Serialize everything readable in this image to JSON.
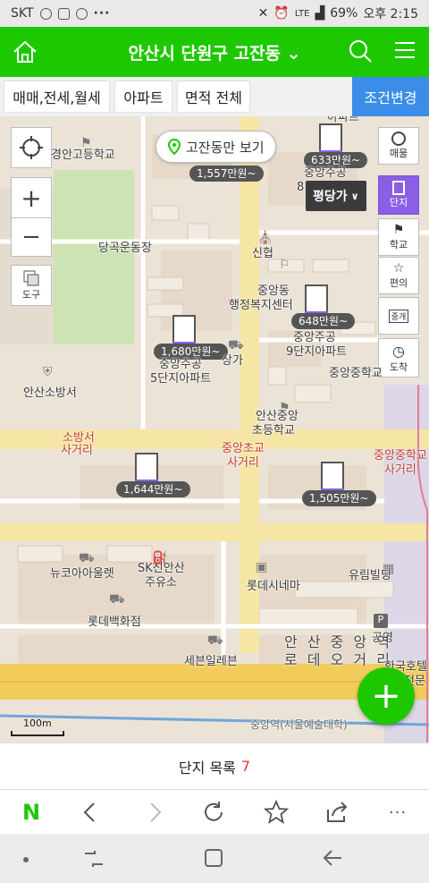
{
  "status": {
    "carrier": "SKT",
    "dots": "···",
    "battery": "69%",
    "time": "오후 2:15",
    "lte": "LTE"
  },
  "header": {
    "title": "안산시 단원구 고잔동 ⌄"
  },
  "filters": {
    "chip1": "매매,전세,월세",
    "chip2": "아파트",
    "chip3": "면적 전체",
    "cond": "조건변경"
  },
  "map": {
    "area_only": "고잔동만 보기",
    "price_toggle": "평당가",
    "labels": {
      "school1": "경안고등학교",
      "stadium": "당곡운동장",
      "shinhyup": "신협",
      "welfare1": "중앙동",
      "welfare2": "행정복지센터",
      "apt5a": "중앙주공",
      "apt5b": "5단지아파트",
      "apt9a": "중앙주공",
      "apt9b": "9단지아파트",
      "sangga": "상가",
      "fire": "안산소방서",
      "middle": "중앙중학교",
      "elem1": "안산중앙",
      "elem2": "초등학교",
      "fire_int1": "소방서",
      "fire_int2": "사거리",
      "elem_int1": "중앙초교",
      "elem_int2": "사거리",
      "mid_int1": "중앙중학교",
      "mid_int2": "사거리",
      "topapt": "중앙주공",
      "top8": "8",
      "topapt2": "아파트",
      "newcore": "뉴코아아울렛",
      "sk1": "SK신안산",
      "sk2": "주유소",
      "lotte_cinema": "롯데시네마",
      "yurim": "유림빌딩",
      "lotte_dept": "롯데백화점",
      "parking": "공영",
      "station1": "안 산 중 앙 역",
      "station2": "로 데 오 거 리",
      "seven": "세븐일레븐",
      "hotel1": "한국호텔",
      "hotel2": "전문",
      "chungang": "중앙역(서울예술대학)",
      "scale": "100m"
    },
    "prices": {
      "p1": "1,557만원~",
      "p2": "633만원~",
      "p3": "648만원~",
      "p4": "1,680만원~",
      "p5": "1,644만원~",
      "p6": "1,505만원~"
    },
    "side": {
      "maemul": "매물",
      "danji": "단지",
      "school": "학교",
      "conv": "편의",
      "broker": "중개",
      "arrive": "도착",
      "layer": "도구"
    }
  },
  "list": {
    "label": "단지 목록",
    "count": "7"
  },
  "browser": {
    "logo": "N",
    "more": "···"
  },
  "colors": {
    "brand_green": "#1ec800",
    "cond_blue": "#3b8de8",
    "purple": "#8a5fe6"
  }
}
